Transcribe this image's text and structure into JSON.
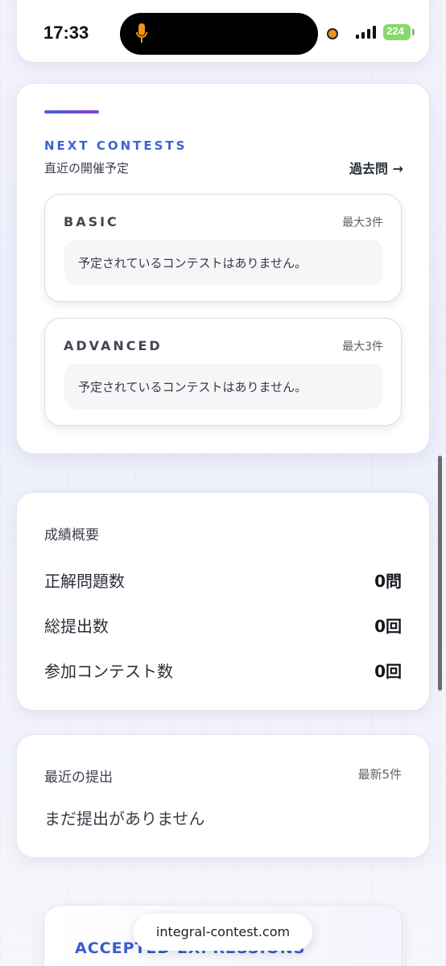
{
  "status_bar": {
    "time": "17:33",
    "battery": "224"
  },
  "next_contests": {
    "eyebrow": "NEXT CONTESTS",
    "subtitle": "直近の開催予定",
    "past_link": "過去問 →",
    "categories": [
      {
        "title": "BASIC",
        "max": "最大3件",
        "empty": "予定されているコンテストはありません。"
      },
      {
        "title": "ADVANCED",
        "max": "最大3件",
        "empty": "予定されているコンテストはありません。"
      }
    ],
    "accent_colors": [
      "#4a63d8",
      "#8a3fd6"
    ]
  },
  "summary": {
    "title": "成績概要",
    "stats": [
      {
        "label": "正解問題数",
        "value": "0問"
      },
      {
        "label": "総提出数",
        "value": "0回"
      },
      {
        "label": "参加コンテスト数",
        "value": "0回"
      }
    ]
  },
  "recent": {
    "title": "最近の提出",
    "max": "最新5件",
    "empty": "まだ提出がありません"
  },
  "bottom_section": {
    "title": "ACCEPTED EXPRESSIONS"
  },
  "browser": {
    "url": "integral-contest.com"
  }
}
